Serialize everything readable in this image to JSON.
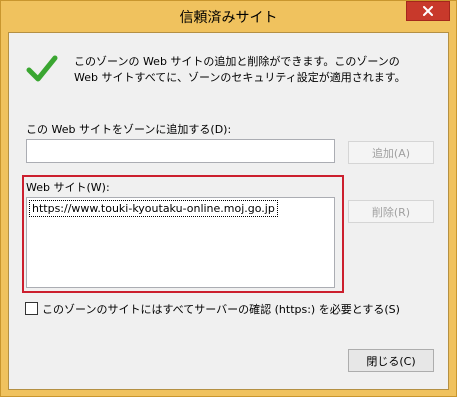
{
  "window": {
    "title": "信頼済みサイト",
    "close_glyph": "✕"
  },
  "description": "このゾーンの Web サイトの追加と削除ができます。このゾーンの Web サイトすべてに、ゾーンのセキュリティ設定が適用されます。",
  "add_section": {
    "label": "この Web サイトをゾーンに追加する(D):",
    "input_value": "",
    "add_button": "追加(A)"
  },
  "websites": {
    "label": "Web サイト(W):",
    "items": [
      "https://www.touki-kyoutaku-online.moj.go.jp"
    ],
    "remove_button": "削除(R)"
  },
  "require_https": {
    "label": "このゾーンのサイトにはすべてサーバーの確認 (https:) を必要とする(S)",
    "checked": false
  },
  "close_button": "閉じる(C)",
  "colors": {
    "frame": "#f0c25e",
    "close": "#c8392b",
    "highlight": "#cc1f2e",
    "check": "#3aa631"
  },
  "icons": {
    "status": "checkmark-icon",
    "close": "close-icon"
  }
}
